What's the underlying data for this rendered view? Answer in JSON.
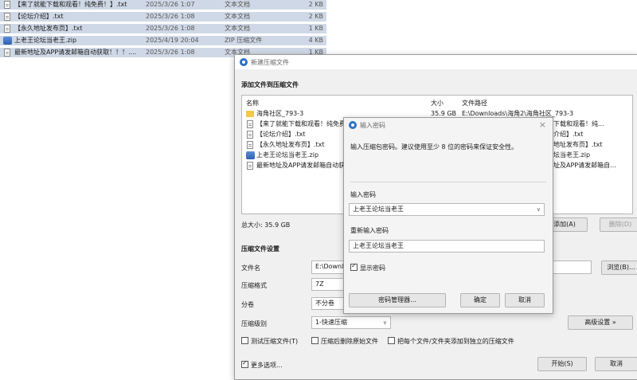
{
  "bg_files": [
    {
      "name": "【来了就能下载和观看！纯免费！】.txt",
      "date": "2025/3/26 1:07",
      "type": "文本文档",
      "size": "2 KB",
      "icon": "text-file-icon"
    },
    {
      "name": "【论坛介绍】.txt",
      "date": "2025/3/26 1:08",
      "type": "文本文档",
      "size": "2 KB",
      "icon": "text-file-icon"
    },
    {
      "name": "【永久地址发布页】.txt",
      "date": "2025/3/26 1:08",
      "type": "文本文档",
      "size": "1 KB",
      "icon": "text-file-icon"
    },
    {
      "name": "上老王论坛当老王.zip",
      "date": "2025/4/19 20:04",
      "type": "ZIP 压缩文件",
      "size": "4 KB",
      "icon": "zip-file-icon"
    },
    {
      "name": "最新地址及APP请发邮箱自动获取！！！....",
      "date": "2025/3/26 1:08",
      "type": "文本文档",
      "size": "1 KB",
      "icon": "text-file-icon"
    }
  ],
  "main_dialog": {
    "title": "新建压缩文件",
    "section_add": "添加文件到压缩文件",
    "col_name": "名称",
    "col_size": "大小",
    "col_path": "文件路径",
    "files": [
      {
        "name": "海角社区_793-3",
        "size": "35.9 GB",
        "path": "E:\\Downloads\\海角2\\海角社区_793-3",
        "icon": "folder-icon"
      },
      {
        "name": "【来了就能下载和观看！纯免费",
        "size": "",
        "path": "就能下载和观看！纯...",
        "icon": "text-file-icon"
      },
      {
        "name": "【论坛介绍】.txt",
        "size": "",
        "path": "介绍】.txt",
        "icon": "text-file-icon"
      },
      {
        "name": "【永久地址发布页】.txt",
        "size": "",
        "path": "地址发布页】.txt",
        "icon": "text-file-icon"
      },
      {
        "name": "上老王论坛当老王.zip",
        "size": "",
        "path": "坛当老王.zip",
        "icon": "zip-file-icon"
      },
      {
        "name": "最新地址及APP请发邮箱自动获",
        "size": "",
        "path": "址及APP请发邮箱自...",
        "icon": "text-file-icon"
      }
    ],
    "total_size": "总大小: 35.9 GB",
    "add_button": "添加(A)",
    "delete_button": "删除(D)",
    "section_settings": "压缩文件设置",
    "filename_label": "文件名",
    "filename_value": "E:\\Downlo",
    "browse_button": "浏览(B)...",
    "format_label": "压缩格式",
    "format_value": "7Z",
    "split_label": "分卷",
    "split_value": "不分卷",
    "level_label": "压缩级别",
    "level_value": "1-快速压缩",
    "advanced_button": "高级设置 »",
    "test_label": "测试压缩文件(T)",
    "delete_after_label": "压缩后删除原始文件",
    "separate_label": "把每个文件/文件夹添加到独立的压缩文件",
    "more_options_label": "更多选项...",
    "start_button": "开始(S)",
    "cancel_button": "取消"
  },
  "pwd_dialog": {
    "title": "输入密码",
    "hint": "输入压缩包密码。建议使用至少 8 位的密码来保证安全性。",
    "enter_label": "输入密码",
    "enter_value": "上老王论坛当老王",
    "reenter_label": "重新输入密码",
    "reenter_value": "上老王论坛当老王",
    "show_label": "显示密码",
    "manager_button": "密码管理器...",
    "ok_button": "确定",
    "cancel_button": "取消",
    "close_symbol": "×"
  },
  "colors": {
    "selection": "#cfd8e6",
    "accent": "#2f6fc6",
    "folder": "#f5c74a"
  }
}
